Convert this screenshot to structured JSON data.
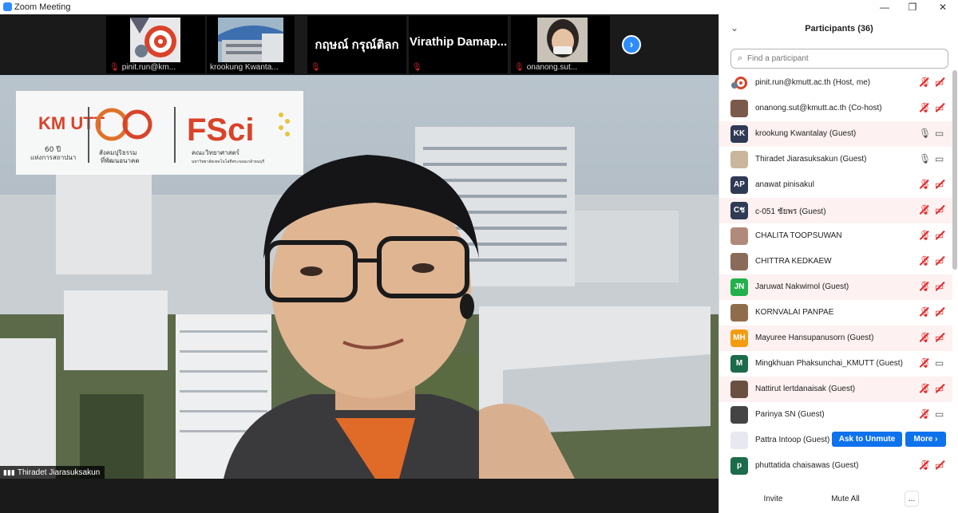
{
  "window": {
    "title": "Zoom Meeting",
    "controls": {
      "minimize": "—",
      "restore": "❐",
      "close": "✕"
    }
  },
  "strip": {
    "tiles": [
      {
        "name": "pinit.run@km...",
        "muted": true
      },
      {
        "name": "krookung Kwanta...",
        "muted": false
      },
      {
        "name": "กฤษณ์  กรุณ์ติลก",
        "muted": true
      },
      {
        "name": "Virathip  Damap...",
        "muted": true
      },
      {
        "name": "onanong.sut...",
        "muted": true
      }
    ],
    "next_icon": "chevron-right-icon"
  },
  "main_video": {
    "speaker": "Thiradet Jiarasuksakun",
    "overlay": {
      "kmutt_text": "KM UTT",
      "kmutt_sub": "60 ปี",
      "kmutt_sub2": "แห่งการสถาปนา",
      "sixty_sub": "สังคมปุริธรรม",
      "sixty_sub2": "ที่พัฒนอนาคต",
      "fsci_text": "FSci",
      "fsci_sub": "คณะวิทยาศาสตร์",
      "fsci_sub2": "มหาวิทยาลัยเทคโนโลยีพระจอมเกล้าธนบุรี"
    }
  },
  "panel": {
    "title": "Participants (36)",
    "search_placeholder": "Find a participant",
    "participants": [
      {
        "name": "pinit.run@kmutt.ac.th (Host, me)",
        "avatar": "",
        "color": "#ffffff",
        "mic": "muted",
        "cam": "off",
        "highlight": false
      },
      {
        "name": "onanong.sut@kmutt.ac.th (Co-host)",
        "avatar": "",
        "color": "#7a5a4a",
        "mic": "muted",
        "cam": "off",
        "highlight": false
      },
      {
        "name": "krookung Kwantalay (Guest)",
        "avatar": "KK",
        "color": "#2f3a54",
        "mic": "on",
        "cam": "on",
        "highlight": true
      },
      {
        "name": "Thiradet Jiarasuksakun (Guest)",
        "avatar": "",
        "color": "#c9b79c",
        "mic": "on",
        "cam": "on",
        "highlight": false
      },
      {
        "name": "anawat pinisakul",
        "avatar": "AP",
        "color": "#2f3a54",
        "mic": "muted",
        "cam": "off",
        "highlight": false
      },
      {
        "name": "c-051 ชัยพร (Guest)",
        "avatar": "Cช",
        "color": "#2f3a54",
        "mic": "muted",
        "cam": "off",
        "highlight": true
      },
      {
        "name": "CHALITA TOOPSUWAN",
        "avatar": "",
        "color": "#b08a7a",
        "mic": "muted",
        "cam": "off",
        "highlight": false
      },
      {
        "name": "CHITTRA KEDKAEW",
        "avatar": "",
        "color": "#8a6b5a",
        "mic": "muted",
        "cam": "off",
        "highlight": false
      },
      {
        "name": "Jaruwat Nakwimol (Guest)",
        "avatar": "JN",
        "color": "#22b14c",
        "mic": "muted",
        "cam": "off",
        "highlight": true
      },
      {
        "name": "KORNVALAI PANPAE",
        "avatar": "",
        "color": "#8f6d4c",
        "mic": "muted",
        "cam": "off",
        "highlight": false
      },
      {
        "name": "Mayuree Hansupanusorn (Guest)",
        "avatar": "MH",
        "color": "#f39c12",
        "mic": "muted",
        "cam": "off",
        "highlight": true
      },
      {
        "name": "Mingkhuan Phaksunchai_KMUTT (Guest)",
        "avatar": "M",
        "color": "#1c6b4a",
        "mic": "muted",
        "cam": "on",
        "highlight": false
      },
      {
        "name": "Nattirut lertdanaisak (Guest)",
        "avatar": "",
        "color": "#6a5040",
        "mic": "muted",
        "cam": "off",
        "highlight": true
      },
      {
        "name": "Parinya SN (Guest)",
        "avatar": "",
        "color": "#444444",
        "mic": "muted",
        "cam": "on",
        "highlight": false
      },
      {
        "name": "Pattra Intoop (Guest)",
        "avatar": "",
        "color": "#e8e8f0",
        "mic": "",
        "cam": "",
        "highlight": false,
        "buttons": true
      },
      {
        "name": "phuttatida chaisawas (Guest)",
        "avatar": "p",
        "color": "#1c6b4a",
        "mic": "muted",
        "cam": "off",
        "highlight": false
      }
    ],
    "ask_to_unmute": "Ask to Unmute",
    "more": "More ›",
    "footer": {
      "invite": "Invite",
      "mute_all": "Mute All",
      "more": "..."
    }
  }
}
